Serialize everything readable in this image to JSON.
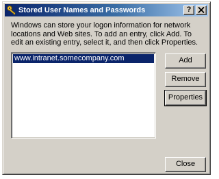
{
  "window": {
    "title": "Stored User Names and Passwords",
    "help_button": "?",
    "close_button": "X"
  },
  "description": "Windows can store your logon information for network locations and Web sites. To add an entry, click Add. To edit an existing entry, select it, and then click Properties.",
  "credentials_list": {
    "items": [
      {
        "label": "www.intranet.somecompany.com",
        "selected": true
      }
    ]
  },
  "buttons": {
    "add": "Add",
    "remove": "Remove",
    "properties": "Properties",
    "close": "Close"
  },
  "colors": {
    "title_bar_start": "#0a246a",
    "title_bar_end": "#a6caf0",
    "dialog_face": "#d4d0c8",
    "selection": "#0a246a"
  },
  "icons": {
    "title": "keys-icon"
  }
}
